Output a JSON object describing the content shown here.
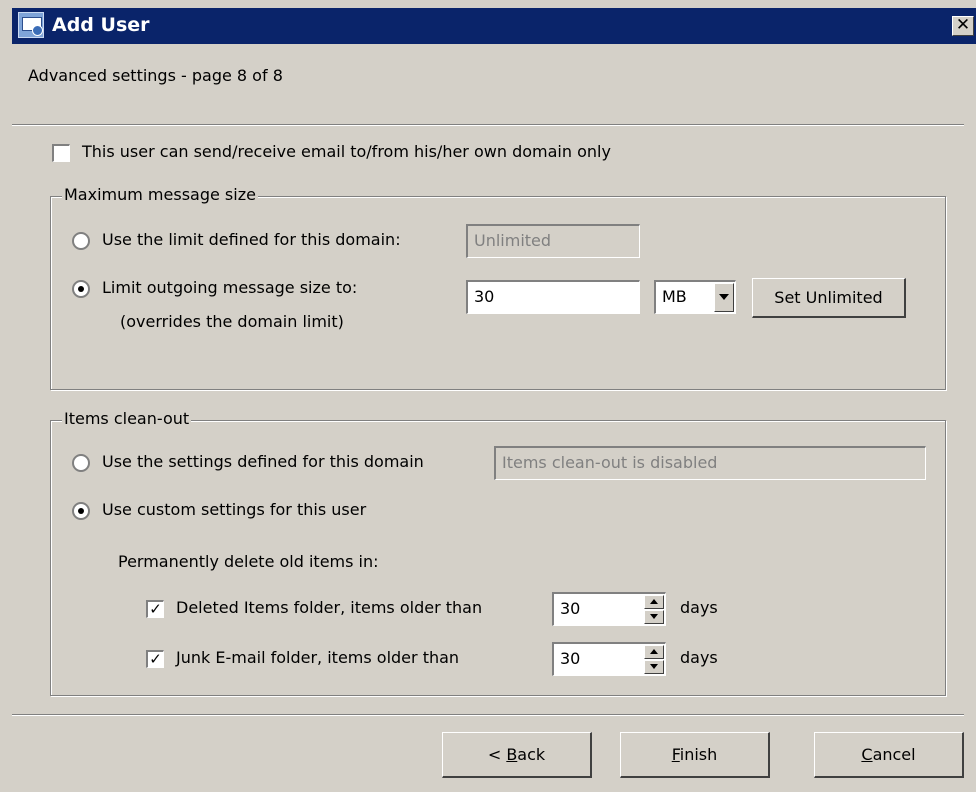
{
  "window": {
    "title": "Add User",
    "close_glyph": "✕",
    "app_icon": "user-settings-icon"
  },
  "header": {
    "subtitle": "Advanced settings - page 8 of 8"
  },
  "own_domain_only": {
    "label": "This user can send/receive email to/from his/her own domain only",
    "checked": false
  },
  "max_message_size": {
    "group_label": "Maximum message size",
    "option_domain": {
      "label": "Use the limit defined for this domain:",
      "selected": false,
      "value": "Unlimited"
    },
    "option_limit": {
      "label_line1": "Limit outgoing message size to:",
      "label_line2": "(overrides the domain limit)",
      "selected": true,
      "value": "30",
      "unit": "MB"
    },
    "set_unlimited_label": "Set Unlimited"
  },
  "items_cleanout": {
    "group_label": "Items clean-out",
    "option_domain": {
      "label": "Use the settings defined for this domain",
      "selected": false,
      "value": "Items clean-out is disabled"
    },
    "option_custom": {
      "label": "Use custom settings for this user",
      "selected": true
    },
    "permanently_delete_label": "Permanently delete old items in:",
    "deleted_items": {
      "label": "Deleted Items folder, items older than",
      "checked": true,
      "value": "30",
      "unit": "days"
    },
    "junk_email": {
      "label": "Junk E-mail folder, items older than",
      "checked": true,
      "value": "30",
      "unit": "days"
    }
  },
  "footer": {
    "back": {
      "mnemonic": "B",
      "prefix": "< ",
      "rest": "ack"
    },
    "finish": {
      "mnemonic": "F",
      "rest": "inish"
    },
    "cancel": {
      "mnemonic": "C",
      "rest": "ancel"
    }
  },
  "colors": {
    "titlebar": "#0a246a",
    "face": "#d4d0c8",
    "disabled_text": "#808080"
  }
}
